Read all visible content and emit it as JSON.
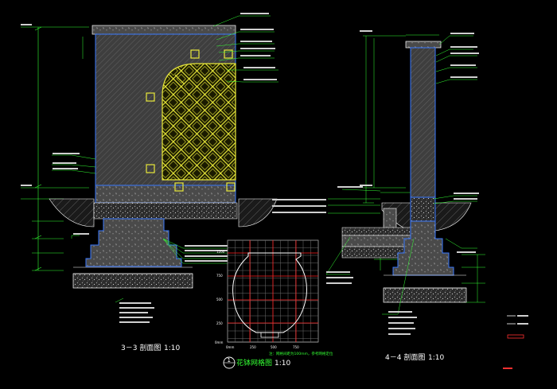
{
  "drawing": {
    "section_3": {
      "title": "3－3 剖面图",
      "scale": "1:10"
    },
    "section_4": {
      "title": "4－4 剖面图",
      "scale": "1:10"
    },
    "pot_detail": {
      "number": "1",
      "title": "花钵网格图",
      "scale": "1:10",
      "grid_note": "注：网格间距为100mm，参考网格定位",
      "y_ticks": [
        "1200",
        "750",
        "500",
        "250",
        "0mm"
      ],
      "x_ticks": [
        "0mm",
        "250",
        "500",
        "750"
      ]
    },
    "legend": {
      "items": [
        "—— 黄线",
        "—— 蓝线"
      ]
    },
    "stamp": "设计",
    "note": "说明"
  },
  "colors": {
    "background": "#000000",
    "structure": "#3a79ff",
    "lattice": "#e8e83a",
    "fill_grey": "#6d6d6d",
    "leader_green": "#33ff33",
    "grid_red": "#ff2020",
    "text_white": "#ffffff",
    "stamp_red": "#ff3030"
  }
}
